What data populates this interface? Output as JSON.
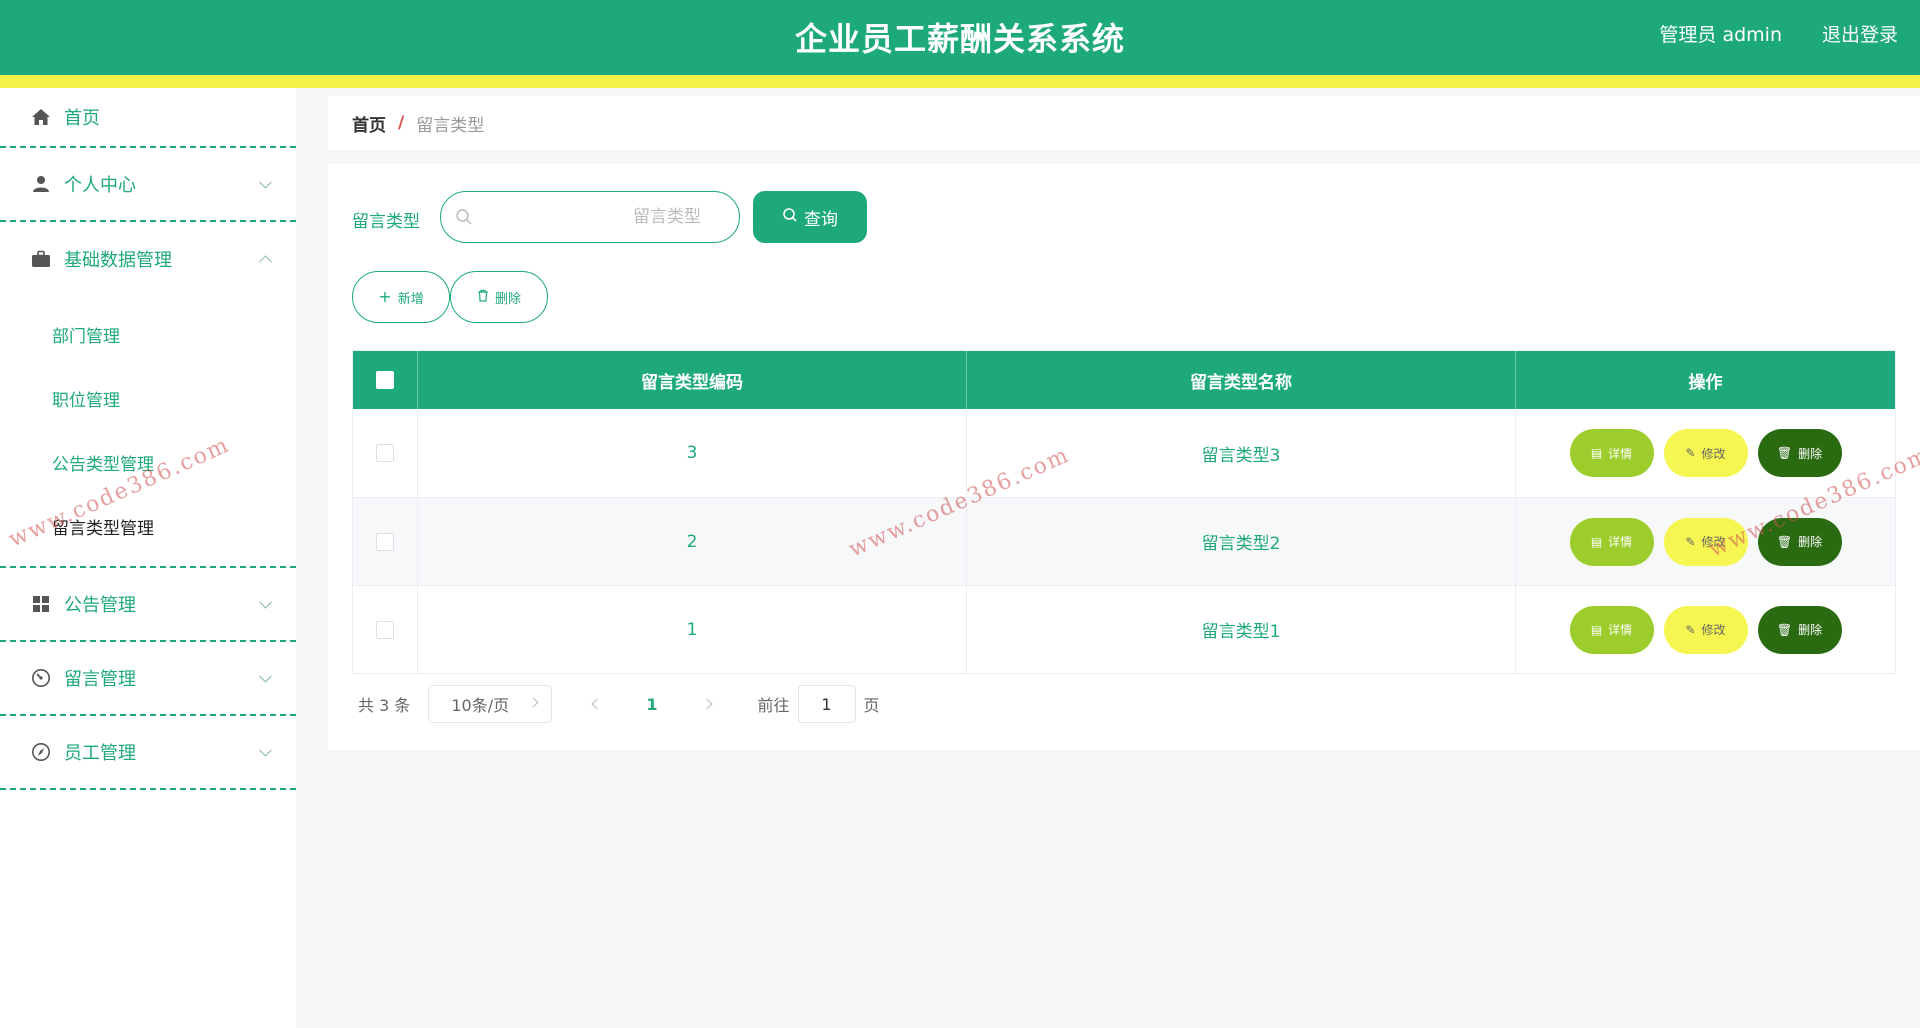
{
  "header": {
    "title": "企业员工薪酬关系系统",
    "user": "管理员 admin",
    "logout": "退出登录"
  },
  "sidebar": {
    "items": [
      {
        "label": "首页",
        "icon": "home-icon"
      },
      {
        "label": "个人中心",
        "icon": "user-icon"
      },
      {
        "label": "基础数据管理",
        "icon": "briefcase-icon"
      },
      {
        "label": "公告管理",
        "icon": "grid-icon"
      },
      {
        "label": "留言管理",
        "icon": "dashboard-icon"
      },
      {
        "label": "员工管理",
        "icon": "compass-icon"
      }
    ],
    "submenu": [
      {
        "label": "部门管理"
      },
      {
        "label": "职位管理"
      },
      {
        "label": "公告类型管理"
      },
      {
        "label": "留言类型管理"
      }
    ]
  },
  "breadcrumb": {
    "home": "首页",
    "separator": "/",
    "current": "留言类型"
  },
  "search": {
    "label": "留言类型",
    "placeholder": "留言类型",
    "button": "查询"
  },
  "actions": {
    "add": "新增",
    "delete": "删除"
  },
  "table": {
    "headers": {
      "code": "留言类型编码",
      "name": "留言类型名称",
      "ops": "操作"
    },
    "rows": [
      {
        "code": "3",
        "name": "留言类型3"
      },
      {
        "code": "2",
        "name": "留言类型2"
      },
      {
        "code": "1",
        "name": "留言类型1"
      }
    ],
    "row_actions": {
      "detail": "详情",
      "edit": "修改",
      "delete": "删除"
    }
  },
  "pagination": {
    "total": "共 3 条",
    "page_size": "10条/页",
    "current_page": "1",
    "goto_label": "前往",
    "goto_value": "1",
    "page_suffix": "页"
  },
  "watermark": {
    "text": "www.code386.com"
  },
  "colors": {
    "primary": "#1ea97c",
    "accent_bar": "#f4f24a",
    "detail_btn": "#9ccd2c",
    "edit_btn": "#f6f652",
    "delete_btn": "#2a6b12"
  }
}
